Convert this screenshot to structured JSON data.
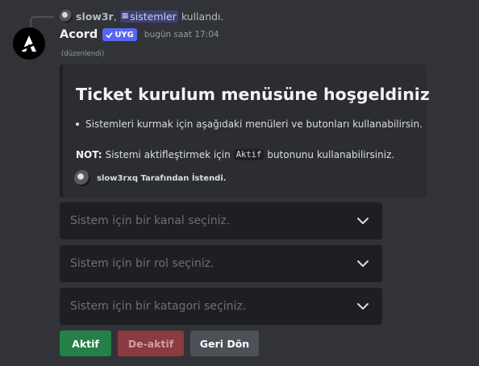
{
  "reply": {
    "username": "slow3r",
    "separator": ",",
    "command": "sistemler",
    "suffix": "kullandı."
  },
  "message": {
    "author": "Acord",
    "app_tag": "UYG",
    "timestamp": "bugün saat 17:04",
    "edited": "(düzenlendi)"
  },
  "embed": {
    "title": "Ticket kurulum menüsüne hoşgeldiniz",
    "bullet": "Sistemleri kurmak için aşağıdaki menüleri ve butonları kullanabilirsin.",
    "note_label": "NOT:",
    "note_before": "Sistemi aktifleştirmek için",
    "note_code": "Aktif",
    "note_after": "butonunu kullanabilirsiniz.",
    "footer": "slow3rxq Tarafından İstendi."
  },
  "selects": [
    {
      "placeholder": "Sistem için bir kanal seçiniz."
    },
    {
      "placeholder": "Sistem için bir rol seçiniz."
    },
    {
      "placeholder": "Sistem için bir katagori seçiniz."
    }
  ],
  "buttons": {
    "activate": "Aktif",
    "deactivate": "De-aktif",
    "back": "Geri Dön"
  },
  "colors": {
    "background": "#313338",
    "embed_background": "#2b2d31",
    "select_background": "#1e1f22",
    "blurple": "#5865f2",
    "success": "#248046",
    "danger_disabled": "#8a3a40",
    "secondary": "#4e5058"
  },
  "icons": {
    "avatar": "acord-logo-icon",
    "select_chevron": "chevron-down-icon",
    "verified": "checkmark-icon",
    "command": "grid-icon"
  }
}
